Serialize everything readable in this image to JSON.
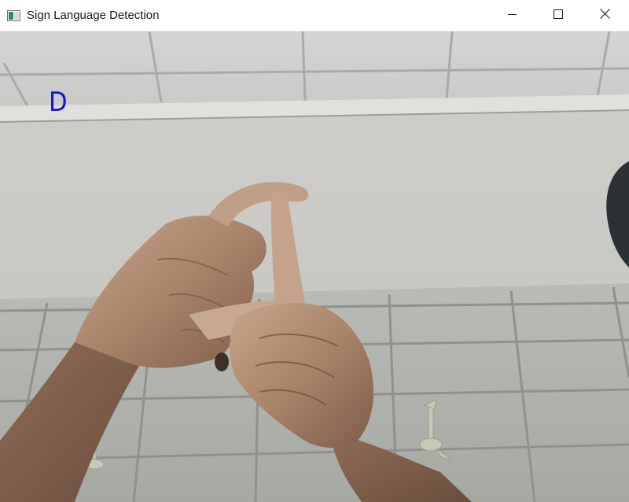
{
  "window": {
    "title": "Sign Language Detection",
    "controls": {
      "minimize_icon": "minimize-icon",
      "maximize_icon": "maximize-icon",
      "close_icon": "close-icon"
    }
  },
  "video": {
    "prediction_label": "D",
    "prediction_color": "#1414e6"
  }
}
